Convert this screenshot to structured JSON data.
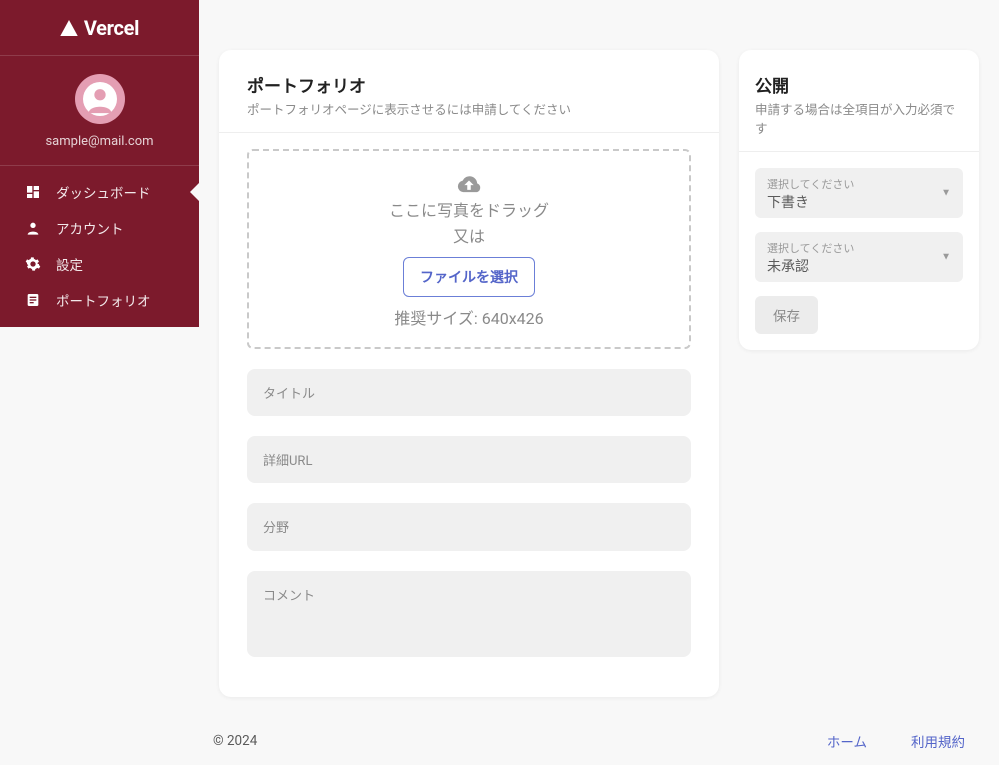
{
  "brand": {
    "name": "Vercel"
  },
  "user": {
    "email": "sample@mail.com"
  },
  "nav": {
    "items": [
      {
        "label": "ダッシュボード",
        "icon": "dashboard-icon",
        "active": true
      },
      {
        "label": "アカウント",
        "icon": "person-icon",
        "active": false
      },
      {
        "label": "設定",
        "icon": "gear-icon",
        "active": false
      },
      {
        "label": "ポートフォリオ",
        "icon": "article-icon",
        "active": false
      }
    ]
  },
  "portfolio_form": {
    "title": "ポートフォリオ",
    "subtitle": "ポートフォリオページに表示させるには申請してください",
    "dropzone": {
      "line1": "ここに写真をドラッグ",
      "line2": "又は",
      "choose_label": "ファイルを選択",
      "recommend": "推奨サイズ: 640x426"
    },
    "fields": {
      "title_label": "タイトル",
      "url_label": "詳細URL",
      "category_label": "分野",
      "comment_label": "コメント"
    }
  },
  "publish_panel": {
    "title": "公開",
    "subtitle": "申請する場合は全項目が入力必須です",
    "status_select": {
      "mini_label": "選択してください",
      "value": "下書き"
    },
    "approval_select": {
      "mini_label": "選択してください",
      "value": "未承認"
    },
    "save_label": "保存"
  },
  "footer": {
    "copyright": "© 2024",
    "links": {
      "home": "ホーム",
      "terms": "利用規約"
    }
  }
}
